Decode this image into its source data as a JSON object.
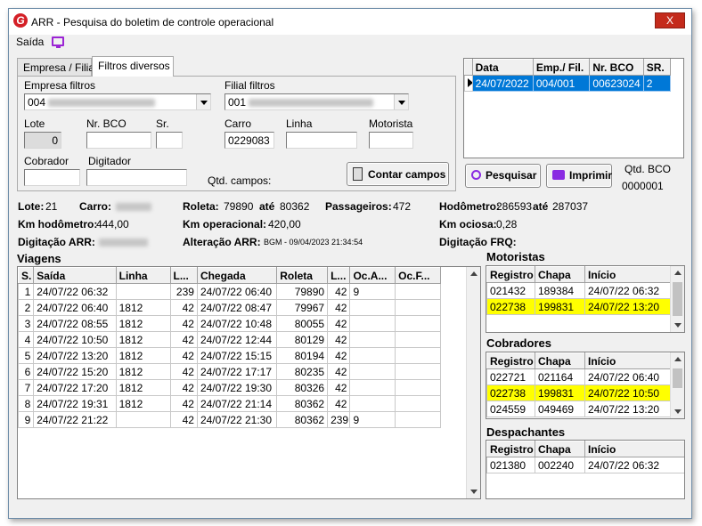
{
  "window": {
    "title": "ARR - Pesquisa do boletim de controle operacional",
    "close": "X",
    "logo": "G"
  },
  "menu": {
    "saida": "Saída"
  },
  "tabs": [
    "Empresa / Filial",
    "Filtros diversos"
  ],
  "filters": {
    "empresa_label": "Empresa filtros",
    "empresa_value": "004",
    "filial_label": "Filial filtros",
    "filial_value": "001",
    "lote_label": "Lote",
    "lote_value": "0",
    "nrbco_label": "Nr. BCO",
    "sr_label": "Sr.",
    "carro_label": "Carro",
    "carro_value": "0229083",
    "linha_label": "Linha",
    "motorista_label": "Motorista",
    "cobrador_label": "Cobrador",
    "digitador_label": "Digitador",
    "qtd_campos_label": "Qtd. campos:",
    "contar_button": "Contar campos"
  },
  "bco_grid": {
    "headers": [
      "Data",
      "Emp./ Fil.",
      "Nr. BCO",
      "SR."
    ],
    "rows": [
      [
        "24/07/2022",
        "004/001",
        "00623024",
        "2"
      ]
    ]
  },
  "actions": {
    "pesquisar": "Pesquisar",
    "imprimir": "Imprimir",
    "qtd_bco_label": "Qtd. BCO",
    "qtd_bco_value": "0000001"
  },
  "summary": {
    "lote_label": "Lote:",
    "lote_value": "21",
    "carro_label": "Carro:",
    "roleta_label": "Roleta:",
    "roleta_from": "79890",
    "ate1": "até",
    "roleta_to": "80362",
    "passageiros_label": "Passageiros:",
    "passageiros_value": "472",
    "hodometro_label": "Hodômetro:",
    "hodometro_from": "286593",
    "ate2": "até",
    "hodometro_to": "287037",
    "km_hodometro_label": "Km hodômetro:",
    "km_hodometro_value": "444,00",
    "km_operacional_label": "Km operacional:",
    "km_operacional_value": "420,00",
    "km_ociosa_label": "Km ociosa:",
    "km_ociosa_value": "0,28",
    "digitacao_arr_label": "Digitação ARR:",
    "alteracao_arr_label": "Alteração ARR:",
    "alteracao_arr_value": "BGM - 09/04/2023 21:34:54",
    "digitacao_frq_label": "Digitação FRQ:"
  },
  "viagens": {
    "title": "Viagens",
    "headers": [
      "S.",
      "Saída",
      "Linha",
      "L...",
      "Chegada",
      "Roleta",
      "L...",
      "Oc.A...",
      "Oc.F..."
    ],
    "rows": [
      [
        "1",
        "24/07/22 06:32",
        "",
        "239",
        "24/07/22 06:40",
        "79890",
        "42",
        "9",
        ""
      ],
      [
        "2",
        "24/07/22 06:40",
        "1812",
        "42",
        "24/07/22 08:47",
        "79967",
        "42",
        "",
        ""
      ],
      [
        "3",
        "24/07/22 08:55",
        "1812",
        "42",
        "24/07/22 10:48",
        "80055",
        "42",
        "",
        ""
      ],
      [
        "4",
        "24/07/22 10:50",
        "1812",
        "42",
        "24/07/22 12:44",
        "80129",
        "42",
        "",
        ""
      ],
      [
        "5",
        "24/07/22 13:20",
        "1812",
        "42",
        "24/07/22 15:15",
        "80194",
        "42",
        "",
        ""
      ],
      [
        "6",
        "24/07/22 15:20",
        "1812",
        "42",
        "24/07/22 17:17",
        "80235",
        "42",
        "",
        ""
      ],
      [
        "7",
        "24/07/22 17:20",
        "1812",
        "42",
        "24/07/22 19:30",
        "80326",
        "42",
        "",
        ""
      ],
      [
        "8",
        "24/07/22 19:31",
        "1812",
        "42",
        "24/07/22 21:14",
        "80362",
        "42",
        "",
        ""
      ],
      [
        "9",
        "24/07/22 21:22",
        "",
        "42",
        "24/07/22 21:30",
        "80362",
        "239",
        "9",
        ""
      ]
    ]
  },
  "motoristas": {
    "title": "Motoristas",
    "headers": [
      "Registro",
      "Chapa",
      "Início"
    ],
    "rows": [
      [
        "021432",
        "189384",
        "24/07/22 06:32"
      ],
      [
        "022738",
        "199831",
        "24/07/22 13:20"
      ]
    ]
  },
  "cobradores": {
    "title": "Cobradores",
    "headers": [
      "Registro",
      "Chapa",
      "Início"
    ],
    "rows": [
      [
        "022721",
        "021164",
        "24/07/22 06:40"
      ],
      [
        "022738",
        "199831",
        "24/07/22 10:50"
      ],
      [
        "024559",
        "049469",
        "24/07/22 13:20"
      ]
    ]
  },
  "despachantes": {
    "title": "Despachantes",
    "headers": [
      "Registro",
      "Chapa",
      "Início"
    ],
    "rows": [
      [
        "021380",
        "002240",
        "24/07/22 06:32"
      ]
    ]
  },
  "colors": {
    "selection": "#0078d7",
    "highlight": "#ffff00",
    "accent": "#8a2be2",
    "close": "#c42b1c"
  }
}
